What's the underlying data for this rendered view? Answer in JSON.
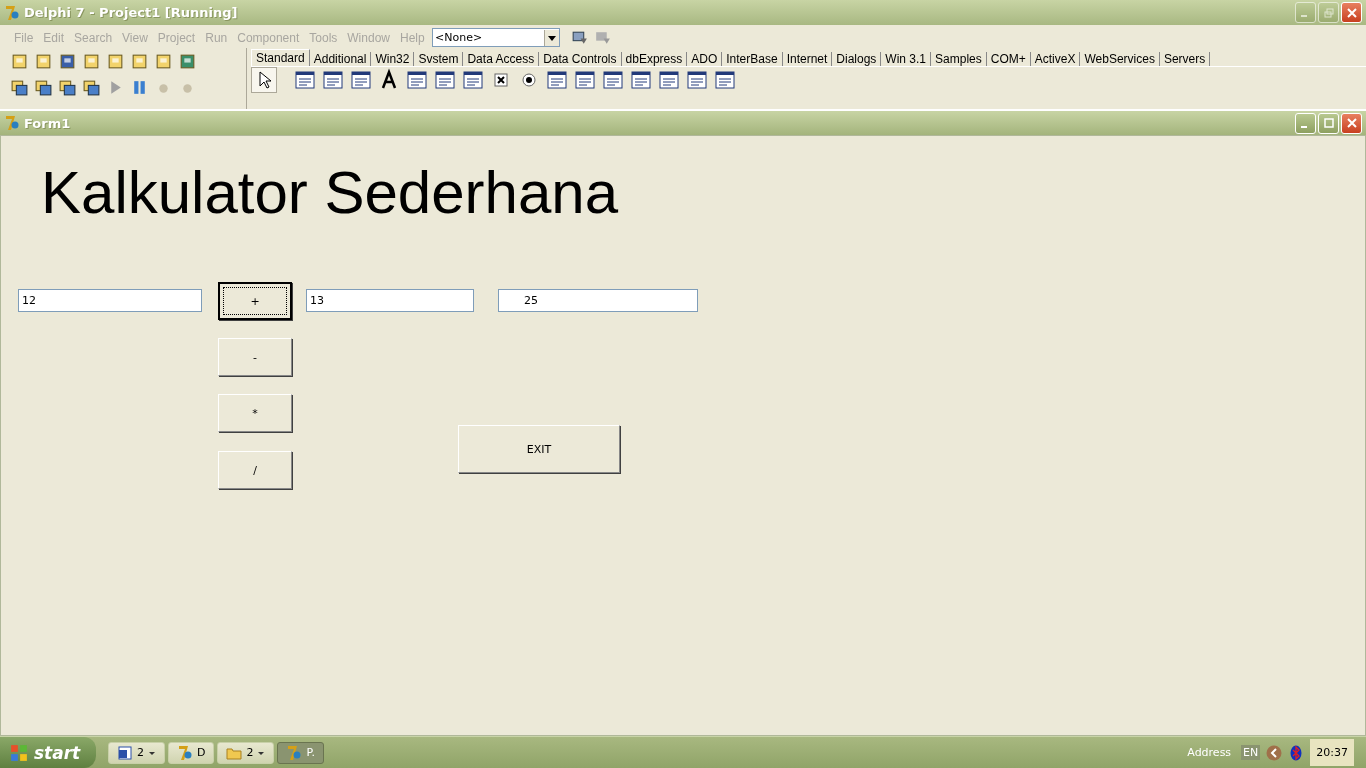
{
  "window": {
    "title": "Delphi 7 - Project1 [Running]"
  },
  "menu": [
    {
      "label": "File",
      "disabled": true
    },
    {
      "label": "Edit",
      "disabled": true
    },
    {
      "label": "Search",
      "disabled": true
    },
    {
      "label": "View",
      "disabled": true
    },
    {
      "label": "Project",
      "disabled": true
    },
    {
      "label": "Run",
      "disabled": true
    },
    {
      "label": "Component",
      "disabled": true
    },
    {
      "label": "Tools",
      "disabled": true
    },
    {
      "label": "Window",
      "disabled": true
    },
    {
      "label": "Help",
      "disabled": true
    }
  ],
  "desktop_combo": {
    "value": "<None>"
  },
  "palette_tabs": [
    {
      "label": "Standard",
      "selected": true
    },
    {
      "label": "Additional",
      "selected": false
    },
    {
      "label": "Win32",
      "selected": false
    },
    {
      "label": "Svstem",
      "selected": false
    },
    {
      "label": "Data Access",
      "selected": false
    },
    {
      "label": "Data Controls",
      "selected": false
    },
    {
      "label": "dbExpress",
      "selected": false
    },
    {
      "label": "ADO",
      "selected": false
    },
    {
      "label": "InterBase",
      "selected": false
    },
    {
      "label": "Internet",
      "selected": false
    },
    {
      "label": "Dialogs",
      "selected": false
    },
    {
      "label": "Win 3.1",
      "selected": false
    },
    {
      "label": "Samples",
      "selected": false
    },
    {
      "label": "COM+",
      "selected": false
    },
    {
      "label": "ActiveX",
      "selected": false
    },
    {
      "label": "WebServices",
      "selected": false
    },
    {
      "label": "Servers",
      "selected": false
    }
  ],
  "form": {
    "title": "Form1",
    "heading": "Kalkulator Sederhana",
    "first_number": "12",
    "second_number": "13",
    "result": "25",
    "operators": [
      {
        "label": "+",
        "focused": true
      },
      {
        "label": "-",
        "focused": false
      },
      {
        "label": "*",
        "focused": false
      },
      {
        "label": "/",
        "focused": false
      }
    ],
    "exit_button": "EXIT"
  },
  "taskbar": {
    "start": "start",
    "buttons": [
      {
        "kind": "word",
        "label": "2",
        "selected": false,
        "group": true
      },
      {
        "kind": "delphi",
        "label": "D",
        "selected": false,
        "group": false
      },
      {
        "kind": "folder",
        "label": "2",
        "selected": false,
        "group": true
      },
      {
        "kind": "delphi",
        "label": "P.",
        "selected": true,
        "group": false
      }
    ],
    "address": "Address",
    "language": "EN",
    "clock": "20:37"
  }
}
